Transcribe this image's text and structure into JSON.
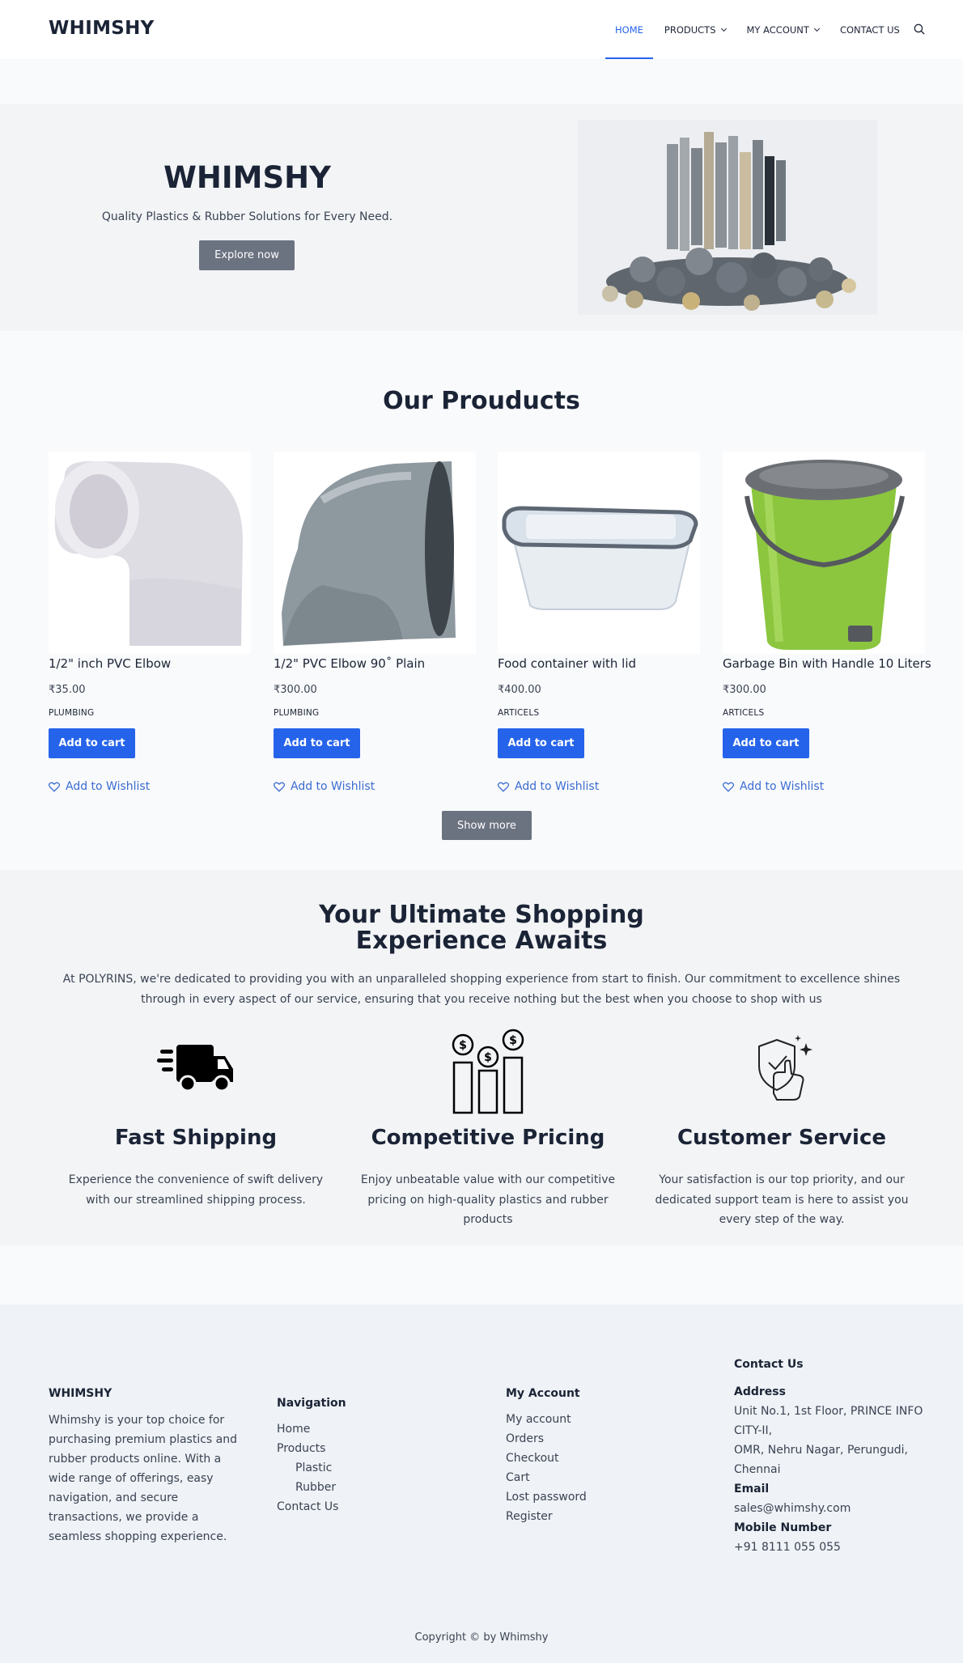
{
  "header": {
    "logo": "WHIMSHY",
    "nav": [
      {
        "label": "HOME",
        "active": true,
        "dropdown": false
      },
      {
        "label": "PRODUCTS",
        "active": false,
        "dropdown": true
      },
      {
        "label": "MY ACCOUNT",
        "active": false,
        "dropdown": true
      },
      {
        "label": "CONTACT US",
        "active": false,
        "dropdown": false
      }
    ],
    "search_icon": "search-icon"
  },
  "hero": {
    "title": "WHIMSHY",
    "subtitle": "Quality Plastics & Rubber Solutions for Every Need.",
    "button": "Explore now",
    "image": "pvc-pipes-and-fittings"
  },
  "products": {
    "title": "Our Prouducts",
    "items": [
      {
        "name": "1/2\" inch PVC Elbow",
        "price": "₹35.00",
        "category": "PLUMBING",
        "cart": "Add to cart",
        "wishlist": "Add to Wishlist",
        "image": "white-pvc-elbow"
      },
      {
        "name": "1/2\" PVC Elbow 90˚ Plain",
        "price": "₹300.00",
        "category": "PLUMBING",
        "cart": "Add to cart",
        "wishlist": "Add to Wishlist",
        "image": "grey-pvc-elbow"
      },
      {
        "name": "Food container with lid",
        "price": "₹400.00",
        "category": "ARTICELS",
        "cart": "Add to cart",
        "wishlist": "Add to Wishlist",
        "image": "food-container"
      },
      {
        "name": "Garbage Bin with Handle 10 Liters",
        "price": "₹300.00",
        "category": "ARTICELS",
        "cart": "Add to cart",
        "wishlist": "Add to Wishlist",
        "image": "green-garbage-bin"
      }
    ],
    "show_more": "Show more"
  },
  "features": {
    "title_line1": "Your Ultimate Shopping",
    "title_line2": "Experience Awaits",
    "description": "At POLYRINS, we're dedicated to providing you with an unparalleled shopping experience from start to finish. Our commitment to excellence shines through in every aspect of our service, ensuring that you receive nothing but the best when you choose to shop with us",
    "items": [
      {
        "icon": "delivery-truck-icon",
        "title": "Fast Shipping",
        "text": "Experience the convenience of swift delivery with our streamlined shipping process."
      },
      {
        "icon": "pricing-chart-icon",
        "title": "Competitive Pricing",
        "text": "Enjoy unbeatable value with our competitive pricing on high-quality plastics and rubber products"
      },
      {
        "icon": "customer-service-icon",
        "title": "Customer Service",
        "text": "Your satisfaction is our top priority, and our dedicated support team is here to assist you every step of the way."
      }
    ]
  },
  "footer": {
    "about": {
      "heading": "WHIMSHY",
      "text": "Whimshy is your top choice for purchasing premium plastics and rubber products online. With a wide range of offerings, easy navigation, and secure transactions, we provide a seamless shopping experience."
    },
    "navigation": {
      "heading": "Navigation",
      "links": [
        "Home",
        "Products",
        "Plastic",
        "Rubber",
        "Contact Us"
      ]
    },
    "account": {
      "heading": "My Account",
      "links": [
        "My account",
        "Orders",
        "Checkout",
        "Cart",
        "Lost password",
        "Register"
      ]
    },
    "contact": {
      "heading": "Contact Us",
      "address_label": "Address",
      "address_line1": "Unit No.1, 1st Floor, PRINCE INFO",
      "address_line2": "CITY-II,",
      "address_line3": "OMR, Nehru Nagar, Perungudi,",
      "address_line4": "Chennai",
      "email_label": "Email",
      "email": "sales@whimshy.com",
      "phone_label": "Mobile Number",
      "phone": "+91 8111 055 055"
    },
    "copyright": "Copyright ©  by Whimshy"
  },
  "colors": {
    "accent": "#2563eb",
    "dark": "#1b2436",
    "gray_button": "#6b7280",
    "section_bg": "#f3f4f6",
    "footer_bg": "#eff2f6"
  }
}
